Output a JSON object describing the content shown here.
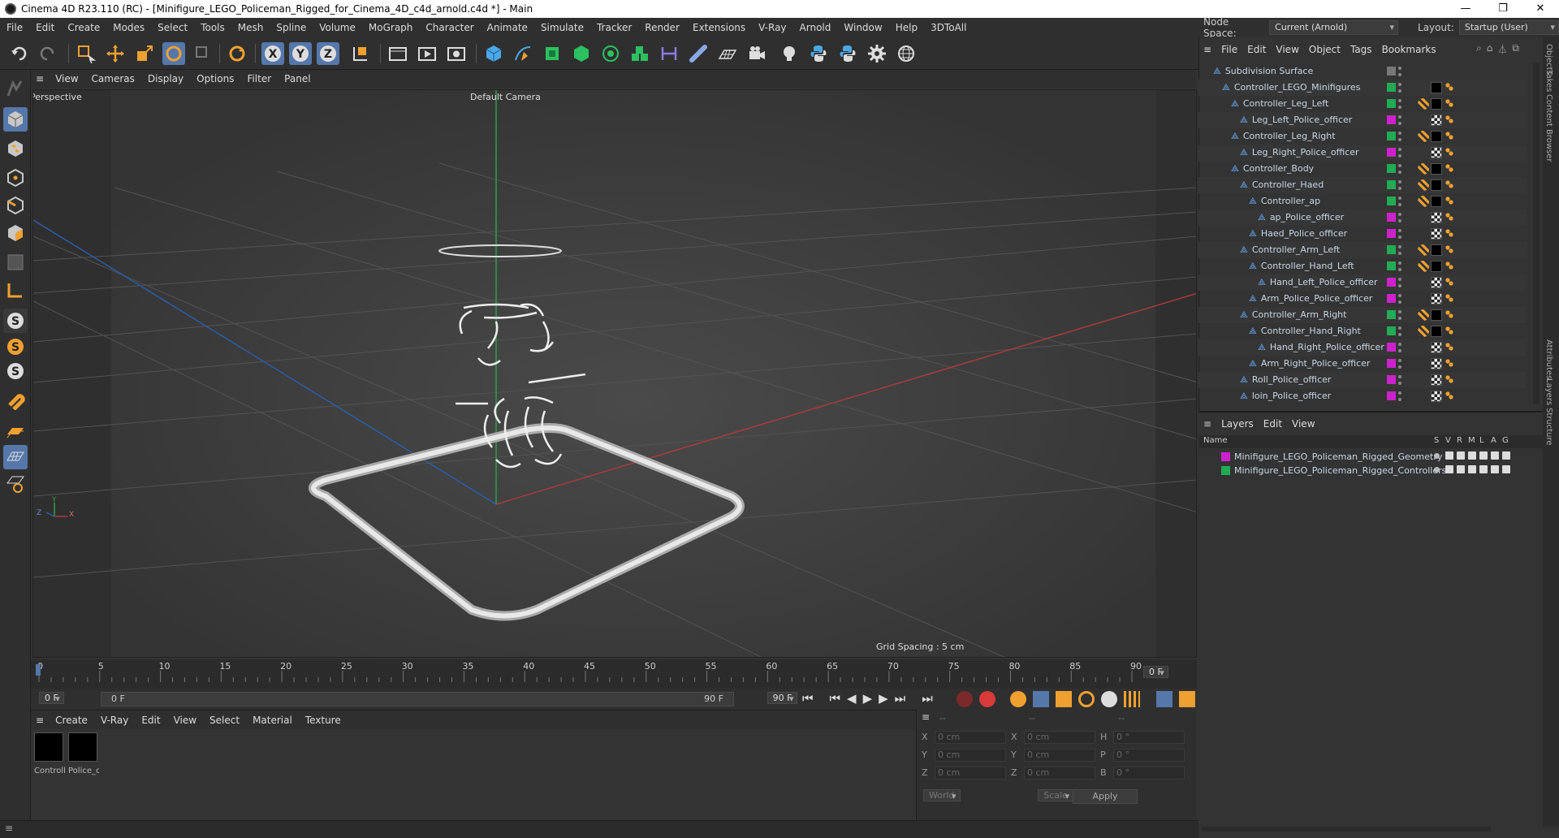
{
  "window": {
    "title": "Cinema 4D R23.110 (RC) - [Minifigure_LEGO_Policeman_Rigged_for_Cinema_4D_c4d_arnold.c4d *] - Main",
    "minimize": "—",
    "maximize": "❐",
    "close": "✕"
  },
  "menubar": [
    "File",
    "Edit",
    "Create",
    "Modes",
    "Select",
    "Tools",
    "Mesh",
    "Spline",
    "Volume",
    "MoGraph",
    "Character",
    "Animate",
    "Simulate",
    "Tracker",
    "Render",
    "Extensions",
    "V-Ray",
    "Arnold",
    "Window",
    "Help",
    "3DToAll"
  ],
  "nodespace": {
    "label": "Node Space:",
    "value": "Current (Arnold)",
    "layout_label": "Layout:",
    "layout_value": "Startup (User)"
  },
  "viewport": {
    "menu": [
      "View",
      "Cameras",
      "Display",
      "Options",
      "Filter",
      "Panel"
    ],
    "view_name": "Perspective",
    "camera": "Default Camera",
    "grid_spacing": "Grid Spacing : 5 cm",
    "axis_y": "Y",
    "axis_z": "Z",
    "axis_x": "X"
  },
  "timeline": {
    "ticks": [
      "0",
      "5",
      "10",
      "15",
      "20",
      "25",
      "30",
      "35",
      "40",
      "45",
      "50",
      "55",
      "60",
      "65",
      "70",
      "75",
      "80",
      "85",
      "90"
    ],
    "current_frame": "0 F",
    "start_field": "0 F",
    "range_start": "0 F",
    "range_end": "90 F",
    "end_field": "90 F"
  },
  "material_menu": [
    "Create",
    "V-Ray",
    "Edit",
    "View",
    "Select",
    "Material",
    "Texture"
  ],
  "materials": [
    {
      "name": "Controlle",
      "color": "#000000"
    },
    {
      "name": "Police_of",
      "color": "#000000"
    }
  ],
  "coords": {
    "header": [
      "--",
      "--",
      "--"
    ],
    "rows": [
      {
        "a": "X",
        "av": "0 cm",
        "b": "X",
        "bv": "0 cm",
        "c": "H",
        "cv": "0 °"
      },
      {
        "a": "Y",
        "av": "0 cm",
        "b": "Y",
        "bv": "0 cm",
        "c": "P",
        "cv": "0 °"
      },
      {
        "a": "Z",
        "av": "0 cm",
        "b": "Z",
        "bv": "0 cm",
        "c": "B",
        "cv": "0 °"
      }
    ],
    "world": "World",
    "scale": "Scale",
    "apply": "Apply"
  },
  "objects_menu": [
    "File",
    "Edit",
    "View",
    "Object",
    "Tags",
    "Bookmarks"
  ],
  "objects": [
    {
      "name": "Subdivision Surface",
      "indent": 0,
      "color": "",
      "tag": "none"
    },
    {
      "name": "Controller_LEGO_Minifigures",
      "indent": 1,
      "color": "#22aa55",
      "tag": "black"
    },
    {
      "name": "Controller_Leg_Left",
      "indent": 2,
      "color": "#22aa55",
      "tag": "ctrl"
    },
    {
      "name": "Leg_Left_Police_officer",
      "indent": 3,
      "color": "#cc22cc",
      "tag": "mat"
    },
    {
      "name": "Controller_Leg_Right",
      "indent": 2,
      "color": "#22aa55",
      "tag": "ctrl"
    },
    {
      "name": "Leg_Right_Police_officer",
      "indent": 3,
      "color": "#cc22cc",
      "tag": "mat"
    },
    {
      "name": "Controller_Body",
      "indent": 2,
      "color": "#22aa55",
      "tag": "ctrl"
    },
    {
      "name": "Controller_Haed",
      "indent": 3,
      "color": "#22aa55",
      "tag": "ctrl"
    },
    {
      "name": "Controller_ap",
      "indent": 4,
      "color": "#22aa55",
      "tag": "ctrl"
    },
    {
      "name": "ap_Police_officer",
      "indent": 5,
      "color": "#cc22cc",
      "tag": "mat"
    },
    {
      "name": "Haed_Police_officer",
      "indent": 4,
      "color": "#cc22cc",
      "tag": "mat"
    },
    {
      "name": "Controller_Arm_Left",
      "indent": 3,
      "color": "#22aa55",
      "tag": "ctrl"
    },
    {
      "name": "Controller_Hand_Left",
      "indent": 4,
      "color": "#22aa55",
      "tag": "ctrl"
    },
    {
      "name": "Hand_Left_Police_officer",
      "indent": 5,
      "color": "#cc22cc",
      "tag": "mat"
    },
    {
      "name": "Arm_Police_Police_officer",
      "indent": 4,
      "color": "#cc22cc",
      "tag": "mat"
    },
    {
      "name": "Controller_Arm_Right",
      "indent": 3,
      "color": "#22aa55",
      "tag": "ctrl"
    },
    {
      "name": "Controller_Hand_Right",
      "indent": 4,
      "color": "#22aa55",
      "tag": "ctrl"
    },
    {
      "name": "Hand_Right_Police_officer",
      "indent": 5,
      "color": "#cc22cc",
      "tag": "mat"
    },
    {
      "name": "Arm_Right_Police_officer",
      "indent": 4,
      "color": "#cc22cc",
      "tag": "mat"
    },
    {
      "name": "Roll_Police_officer",
      "indent": 3,
      "color": "#cc22cc",
      "tag": "mat"
    },
    {
      "name": "loin_Police_officer",
      "indent": 3,
      "color": "#cc22cc",
      "tag": "mat"
    }
  ],
  "layers_menu": [
    "Layers",
    "Edit",
    "View"
  ],
  "layers_header": {
    "name": "Name",
    "cols": [
      "S",
      "V",
      "R",
      "M",
      "L",
      "A",
      "G"
    ]
  },
  "layers": [
    {
      "name": "Minifigure_LEGO_Policeman_Rigged_Geometry",
      "color": "#cc22cc"
    },
    {
      "name": "Minifigure_LEGO_Policeman_Rigged_Controllers",
      "color": "#22aa55"
    }
  ],
  "right_tabs": [
    "Objects",
    "Takes",
    "Content Browser",
    "Attributes",
    "Layers",
    "Structure"
  ],
  "colors": {
    "accent": "#5577aa",
    "green": "#22aa55",
    "magenta": "#cc22cc"
  }
}
